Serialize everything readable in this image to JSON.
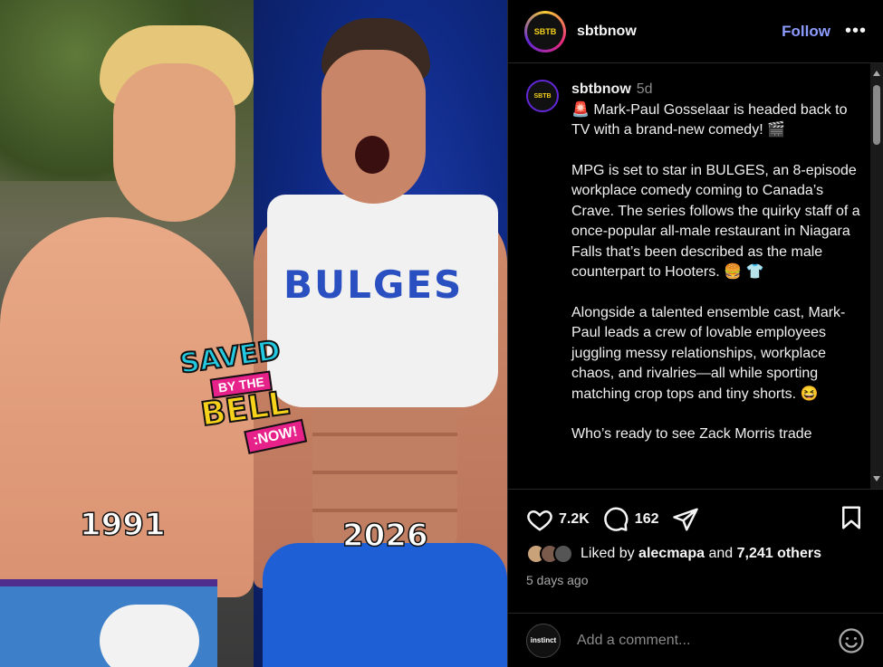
{
  "post": {
    "author": "sbtbnow",
    "follow_label": "Follow",
    "more_label": "•••",
    "avatar_text": "SAVED BY THE BELL",
    "image": {
      "logo": {
        "saved": "SAVED",
        "by_the": "BY THE",
        "bell": "BELL",
        "now": ":NOW!"
      },
      "shirt_text": "BULGES",
      "year_left": "1991",
      "year_right": "2026"
    }
  },
  "caption": {
    "username": "sbtbnow",
    "time": "5d",
    "paragraphs": [
      "🚨 Mark-Paul Gosselaar is headed back to TV with a brand-new comedy! 🎬",
      "MPG is set to star in BULGES, an 8-episode workplace comedy coming to Canada’s Crave. The series follows the quirky staff of a once-popular all-male restaurant in Niagara Falls that’s been described as the male counterpart to Hooters. 🍔 👕",
      "Alongside a talented ensemble cast, Mark-Paul leads a crew of lovable employees juggling messy relationships, workplace chaos, and rivalries—all while sporting matching crop tops and tiny shorts. 😆",
      "Who’s ready to see Zack Morris trade"
    ]
  },
  "actions": {
    "likes": "7.2K",
    "comments": "162",
    "liked_by_prefix": "Liked by",
    "liked_by_user": "alecmapa",
    "liked_by_and": "and",
    "liked_by_others": "7,241 others",
    "date": "5 days ago"
  },
  "comment_box": {
    "avatar_text": "instinct",
    "placeholder": "Add a comment..."
  },
  "colors": {
    "follow": "#8c9bff",
    "background": "#000000",
    "divider": "#262626"
  }
}
